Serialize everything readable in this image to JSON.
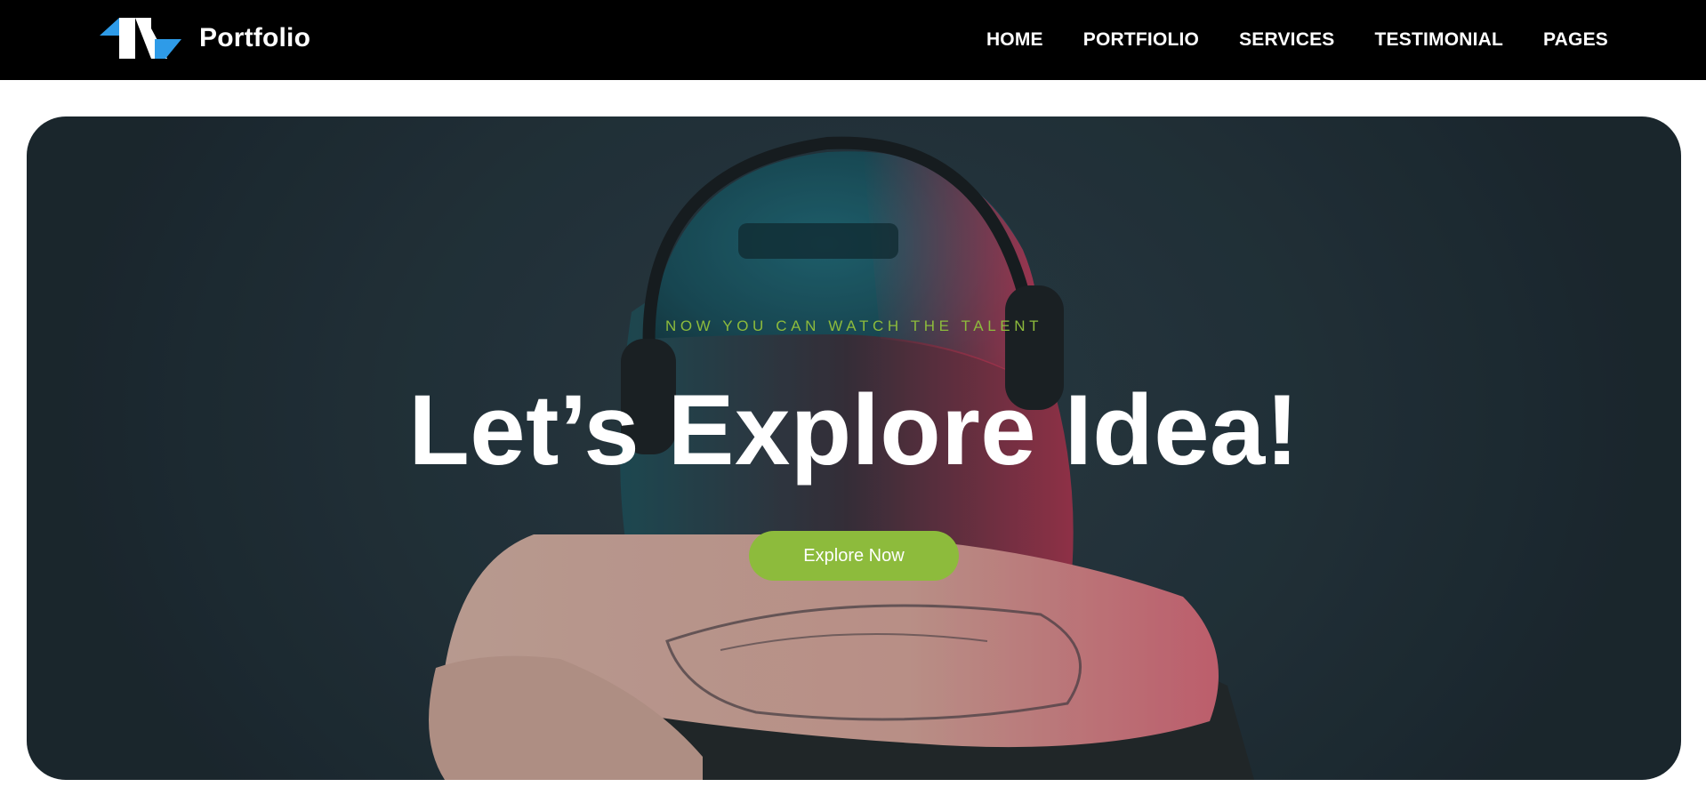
{
  "brand": {
    "name": "Portfolio",
    "logo_icon": "portfolio-logo-icon",
    "colors": {
      "accent_blue": "#2e9be8",
      "accent_green": "#8dbb3c"
    }
  },
  "nav": {
    "items": [
      {
        "label": "HOME"
      },
      {
        "label": "PORTFIOLIO"
      },
      {
        "label": "SERVICES"
      },
      {
        "label": "TESTIMONIAL"
      },
      {
        "label": "PAGES"
      }
    ]
  },
  "hero": {
    "eyebrow": "NOW YOU CAN WATCH THE TALENT",
    "headline": "Let’s Explore Idea!",
    "cta_label": "Explore Now",
    "background_photo": "person-with-headphones-and-cap-photo"
  }
}
